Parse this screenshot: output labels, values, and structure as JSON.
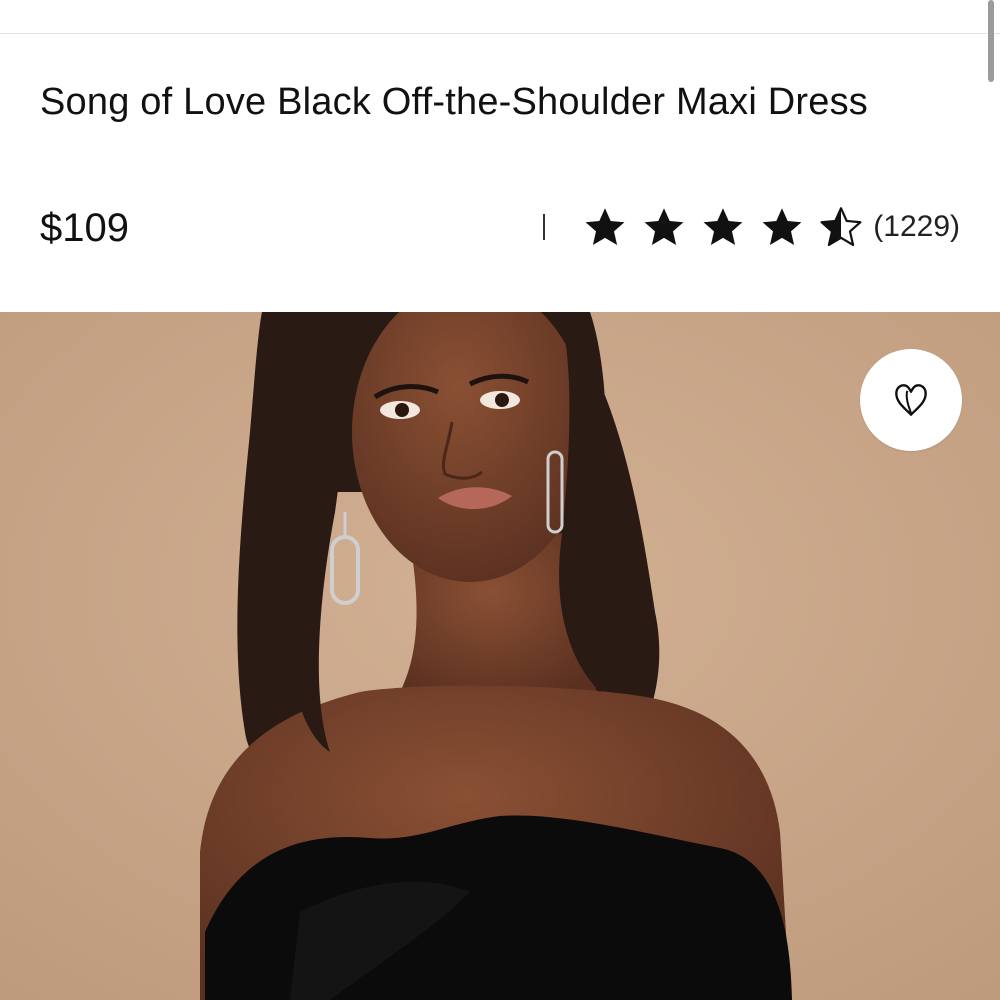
{
  "product": {
    "title": "Song of Love Black Off-the-Shoulder Maxi Dress",
    "price": "$109",
    "rating": 4.5,
    "rating_max": 5,
    "review_count": "(1229)"
  },
  "hero": {
    "image": "product-photo",
    "background_color": "#c8a587",
    "favorite_icon": "heart-icon"
  },
  "icons": {
    "star_filled": "star-icon",
    "star_half": "star-half-icon"
  },
  "colors": {
    "text": "#111111",
    "star": "#111111",
    "hero_background": "#c8a587"
  }
}
